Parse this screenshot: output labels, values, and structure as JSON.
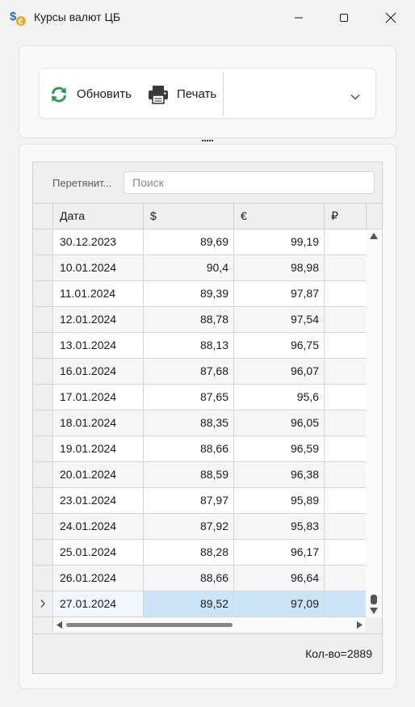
{
  "window": {
    "title": "Курсы валют ЦБ",
    "icon": "currency-dollar-euro-icon"
  },
  "toolbar": {
    "refresh_label": "Обновить",
    "print_label": "Печать"
  },
  "grid": {
    "group_hint": "Перетянит...",
    "search_placeholder": "Поиск",
    "columns": [
      "Дата",
      "$",
      "€",
      "₽"
    ],
    "rows": [
      [
        "30.12.2023",
        "89,69",
        "99,19",
        ""
      ],
      [
        "10.01.2024",
        "90,4",
        "98,98",
        ""
      ],
      [
        "11.01.2024",
        "89,39",
        "97,87",
        ""
      ],
      [
        "12.01.2024",
        "88,78",
        "97,54",
        ""
      ],
      [
        "13.01.2024",
        "88,13",
        "96,75",
        ""
      ],
      [
        "16.01.2024",
        "87,68",
        "96,07",
        ""
      ],
      [
        "17.01.2024",
        "87,65",
        "95,6",
        ""
      ],
      [
        "18.01.2024",
        "88,35",
        "96,05",
        ""
      ],
      [
        "19.01.2024",
        "88,66",
        "96,59",
        ""
      ],
      [
        "20.01.2024",
        "88,59",
        "96,38",
        ""
      ],
      [
        "23.01.2024",
        "87,97",
        "95,89",
        ""
      ],
      [
        "24.01.2024",
        "87,92",
        "95,83",
        ""
      ],
      [
        "25.01.2024",
        "88,28",
        "96,17",
        ""
      ],
      [
        "26.01.2024",
        "88,66",
        "96,64",
        ""
      ],
      [
        "27.01.2024",
        "89,52",
        "97,09",
        ""
      ]
    ],
    "selected_row": 14,
    "footer_count": "Кол-во=2889"
  },
  "colors": {
    "selection": "#cce4f7",
    "refresh_icon": "#2e9b55"
  }
}
